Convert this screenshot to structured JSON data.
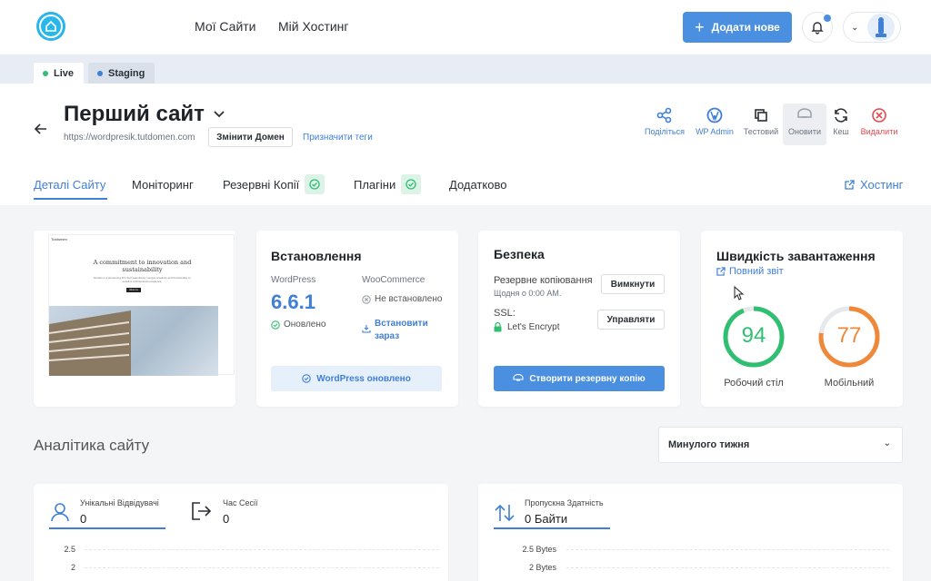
{
  "nav": {
    "my_sites": "Мої Сайти",
    "my_hosting": "Мій Хостинг",
    "add_new": "Додати нове"
  },
  "env": {
    "live": "Live",
    "staging": "Staging"
  },
  "site": {
    "title": "Перший сайт",
    "url": "https://wordpresik.tutdomen.com",
    "change_domain": "Змінити Домен",
    "assign_tags": "Призначити теги"
  },
  "actions": [
    {
      "label": "Поділіться",
      "icon": "share-icon"
    },
    {
      "label": "WP Admin",
      "icon": "wordpress-icon"
    },
    {
      "label": "Тестовий",
      "icon": "copy-icon"
    },
    {
      "label": "Оновити",
      "icon": "update-icon"
    },
    {
      "label": "Кеш",
      "icon": "refresh-icon"
    },
    {
      "label": "Видалити",
      "icon": "delete-icon"
    }
  ],
  "tabs": {
    "details": "Деталі Сайту",
    "monitoring": "Моніторинг",
    "backups": "Резервні Копії",
    "plugins": "Плагіни",
    "additional": "Додатково",
    "hosting": "Хостинг"
  },
  "preview": {
    "site_name": "Tutdomen",
    "headline": "A commitment to innovation and sustainability",
    "subline": "Etudes is a pioneering firm that seamlessly merges creativity and functionality to redefine architectural excellence.",
    "button": "About us"
  },
  "install": {
    "title": "Встановлення",
    "wp_label": "WordPress",
    "wp_version": "6.6.1",
    "wp_status": "Оновлено",
    "woo_label": "WooCommerce",
    "woo_status": "Не встановлено",
    "woo_install": "Встановити зараз",
    "button": "WordPress оновлено"
  },
  "security": {
    "title": "Безпека",
    "backup_label": "Резервне копіювання",
    "backup_schedule": "Щодня о 0:00 AM.",
    "backup_button": "Вимкнути",
    "ssl_label": "SSL:",
    "ssl_provider": "Let's Encrypt",
    "ssl_button": "Управляти",
    "create_backup": "Створити резервну копію"
  },
  "speed": {
    "title": "Швидкість завантаження",
    "full_report": "Повний звіт",
    "desktop_score": 94,
    "desktop_label": "Робочий стіл",
    "mobile_score": 77,
    "mobile_label": "Мобільний",
    "desktop_color": "#2fbf71",
    "mobile_color": "#f0883a"
  },
  "analytics": {
    "title": "Аналітика сайту",
    "period": "Минулого тижня",
    "visitors_label": "Унікальні Відвідувачі",
    "visitors_value": "0",
    "session_label": "Час Сесії",
    "session_value": "0",
    "bandwidth_label": "Пропускна Здатність",
    "bandwidth_value": "0 Байти",
    "left_ticks": [
      "2.5",
      "2"
    ],
    "right_ticks": [
      "2.5 Bytes",
      "2 Bytes"
    ]
  },
  "colors": {
    "accent": "#4a8fe0",
    "link": "#3f7fd6",
    "danger": "#e5484d",
    "success": "#2fbf71"
  }
}
